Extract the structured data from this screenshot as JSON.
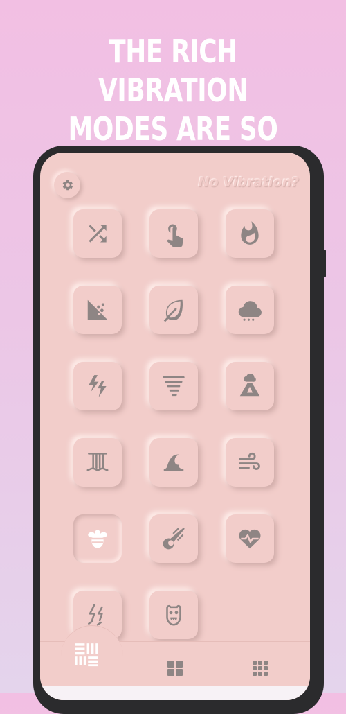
{
  "headline": {
    "line1": "THE RICH VIBRATION",
    "line2": "MODES ARE SO COOL"
  },
  "app": {
    "no_vibration_label": "No Vibration?",
    "accent_color": "#f2cdca",
    "icon_color": "#8e8584"
  },
  "modes": [
    {
      "icon": "shuffle-icon"
    },
    {
      "icon": "tap-icon"
    },
    {
      "icon": "fire-icon"
    },
    {
      "icon": "landslide-icon"
    },
    {
      "icon": "leaf-icon"
    },
    {
      "icon": "snow-cloud-icon"
    },
    {
      "icon": "lightning-icon"
    },
    {
      "icon": "tornado-icon"
    },
    {
      "icon": "volcano-icon"
    },
    {
      "icon": "waterfall-icon"
    },
    {
      "icon": "wave-icon"
    },
    {
      "icon": "wind-icon"
    },
    {
      "icon": "bee-icon",
      "selected": true
    },
    {
      "icon": "meteor-icon"
    },
    {
      "icon": "heartbeat-icon"
    },
    {
      "icon": "storm-icon"
    },
    {
      "icon": "monster-icon"
    }
  ],
  "bottom_nav": [
    {
      "icon": "list-layout-icon",
      "active": true
    },
    {
      "icon": "grid-large-icon",
      "active": false
    },
    {
      "icon": "grid-small-icon",
      "active": false
    }
  ]
}
